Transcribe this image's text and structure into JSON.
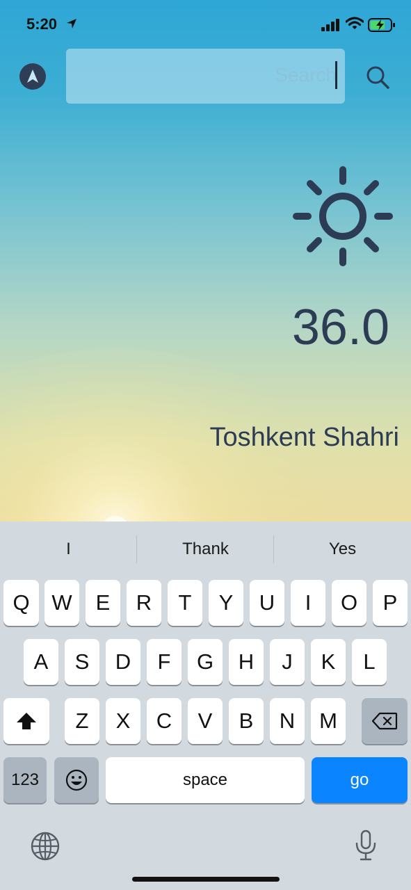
{
  "status_bar": {
    "time": "5:20"
  },
  "search": {
    "placeholder": "Search"
  },
  "weather": {
    "temperature": "36.0",
    "city": "Toshkent Shahri",
    "condition_icon": "sun-icon"
  },
  "keyboard": {
    "suggestions": [
      "I",
      "Thank",
      "Yes"
    ],
    "row1": [
      "Q",
      "W",
      "E",
      "R",
      "T",
      "Y",
      "U",
      "I",
      "O",
      "P"
    ],
    "row2": [
      "A",
      "S",
      "D",
      "F",
      "G",
      "H",
      "J",
      "K",
      "L"
    ],
    "row3": [
      "Z",
      "X",
      "C",
      "V",
      "B",
      "N",
      "M"
    ],
    "numbers_label": "123",
    "space_label": "space",
    "go_label": "go"
  },
  "colors": {
    "text_dark": "#2c3c55",
    "accent_blue": "#0a84ff",
    "sky_top": "#2ea6d6",
    "sky_bottom": "#ecdca0"
  }
}
